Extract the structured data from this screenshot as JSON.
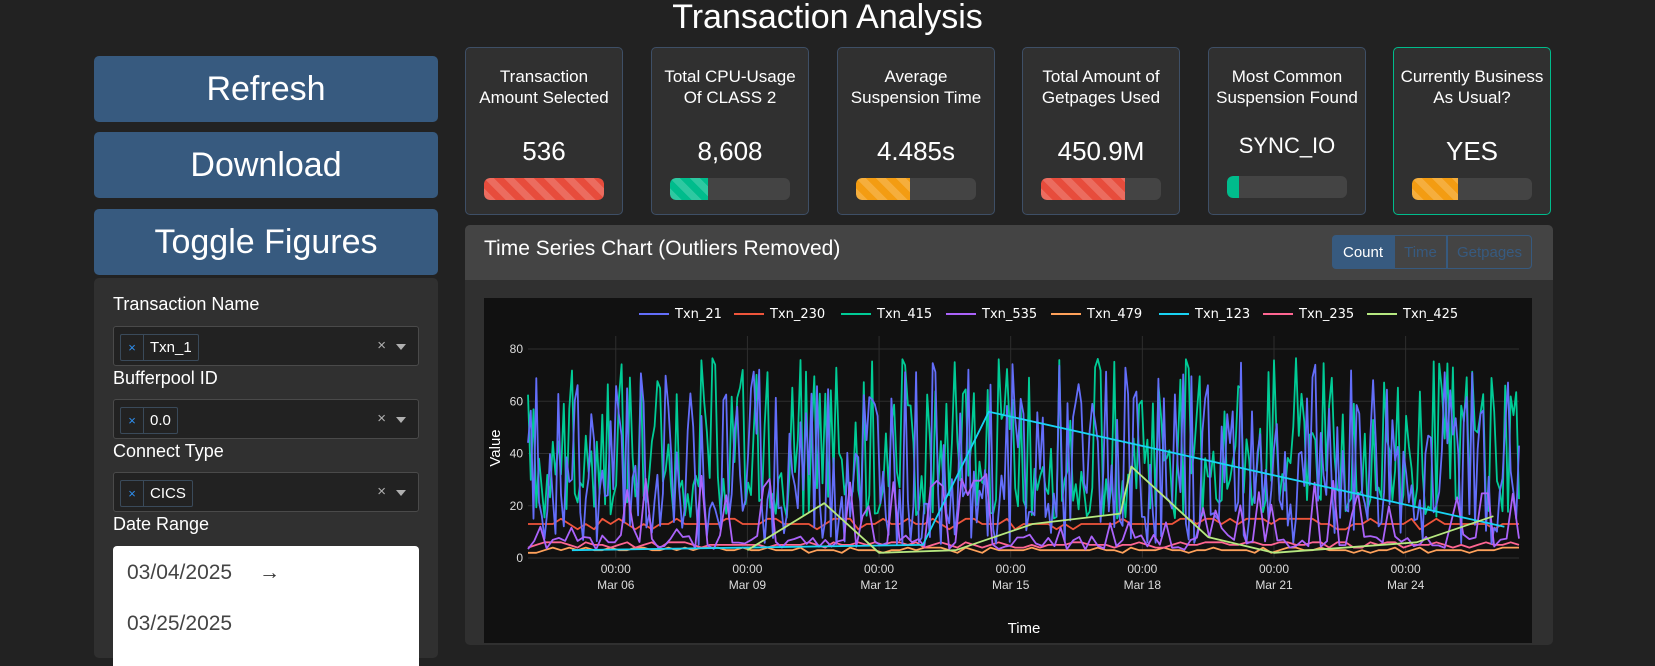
{
  "page": {
    "title": "Transaction Analysis"
  },
  "sidebar": {
    "buttons": [
      {
        "label": "Refresh"
      },
      {
        "label": "Download"
      },
      {
        "label": "Toggle Figures"
      }
    ],
    "filters": {
      "transaction_name": {
        "label": "Transaction Name",
        "value": "Txn_1"
      },
      "bufferpool_id": {
        "label": "Bufferpool ID",
        "value": "0.0"
      },
      "connect_type": {
        "label": "Connect Type",
        "value": "CICS"
      },
      "date_range": {
        "label": "Date Range",
        "start": "03/04/2025",
        "end": "03/25/2025",
        "arrow": "→"
      }
    },
    "remove_glyph": "×",
    "clear_glyph": "×"
  },
  "kpis": [
    {
      "title": "Transaction Amount Selected",
      "value": "536",
      "progress": 1.0,
      "color": "#e74c3c",
      "striped": true
    },
    {
      "title": "Total CPU-Usage Of CLASS 2",
      "value": "8,608",
      "progress": 0.32,
      "color": "#00bc8c",
      "striped": true
    },
    {
      "title": "Average Suspension Time",
      "value": "4.485s",
      "progress": 0.45,
      "color": "#f39c12",
      "striped": true
    },
    {
      "title": "Total Amount of Getpages Used",
      "value": "450.9M",
      "progress": 0.7,
      "color": "#e74c3c",
      "striped": true
    },
    {
      "title": "Most Common Suspension Found",
      "value": "SYNC_IO",
      "progress": 0.1,
      "color": "#00bc8c",
      "striped": false
    },
    {
      "title": "Currently Business As Usual?",
      "value": "YES",
      "progress": 0.38,
      "color": "#f39c12",
      "striped": true
    }
  ],
  "chart_section": {
    "title": "Time Series Chart (Outliers Removed)",
    "toggle": {
      "options": [
        "Count",
        "Time",
        "Getpages"
      ],
      "selected": "Count"
    }
  },
  "chart_data": {
    "type": "line",
    "xlabel": "Time",
    "ylabel": "Value",
    "x_ticks": [
      [
        "00:00",
        "Mar 06"
      ],
      [
        "00:00",
        "Mar 09"
      ],
      [
        "00:00",
        "Mar 12"
      ],
      [
        "00:00",
        "Mar 15"
      ],
      [
        "00:00",
        "Mar 18"
      ],
      [
        "00:00",
        "Mar 21"
      ],
      [
        "00:00",
        "Mar 24"
      ]
    ],
    "x_range": [
      "2025-03-04T00:00",
      "2025-03-26T14:00"
    ],
    "y_ticks": [
      0,
      20,
      40,
      60,
      80
    ],
    "ylim": [
      0,
      85
    ],
    "grid": true,
    "legend_position": "top",
    "series": [
      {
        "name": "Txn_21",
        "color": "#636efa",
        "style": "noisy",
        "base": 5,
        "amp": 70
      },
      {
        "name": "Txn_230",
        "color": "#ef553b",
        "style": "flat",
        "base": 13,
        "amp": 2
      },
      {
        "name": "Txn_415",
        "color": "#00cc96",
        "style": "noisy",
        "base": 15,
        "amp": 62
      },
      {
        "name": "Txn_535",
        "color": "#ab63fa",
        "style": "sparse",
        "base": 3,
        "amp": 30
      },
      {
        "name": "Txn_479",
        "color": "#ffa15a",
        "style": "flat",
        "base": 3,
        "amp": 1
      },
      {
        "name": "Txn_123",
        "color": "#19d3f3",
        "style": "points",
        "points": [
          [
            "2025-03-05T00:00",
            3
          ],
          [
            "2025-03-13T00:00",
            5
          ],
          [
            "2025-03-14T12:00",
            56
          ],
          [
            "2025-03-26T06:00",
            12
          ]
        ]
      },
      {
        "name": "Txn_235",
        "color": "#ff6692",
        "style": "flat",
        "base": 5,
        "amp": 1
      },
      {
        "name": "Txn_425",
        "color": "#b6e880",
        "style": "points",
        "points": [
          [
            "2025-03-09T00:00",
            3
          ],
          [
            "2025-03-10T18:00",
            21
          ],
          [
            "2025-03-12T00:00",
            2
          ],
          [
            "2025-03-13T18:00",
            3
          ],
          [
            "2025-03-15T12:00",
            13
          ],
          [
            "2025-03-17T12:00",
            17
          ],
          [
            "2025-03-17T18:00",
            35
          ],
          [
            "2025-03-19T12:00",
            8
          ],
          [
            "2025-03-21T00:00",
            2
          ],
          [
            "2025-03-24T06:00",
            6
          ],
          [
            "2025-03-26T00:00",
            16
          ]
        ]
      }
    ]
  }
}
